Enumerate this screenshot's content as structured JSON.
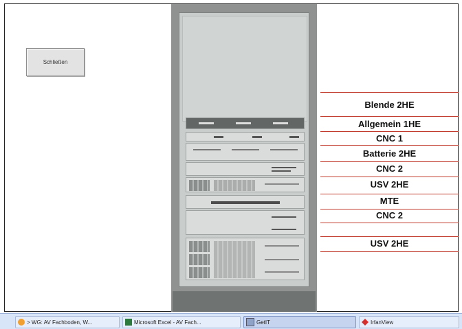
{
  "close_button": "Schließen",
  "rack_labels": [
    "Blende 2HE",
    "Allgemein 1HE",
    "CNC 1",
    "Batterie 2HE",
    "CNC 2",
    "USV 2HE",
    "MTE",
    "CNC 2",
    "USV 2HE"
  ],
  "taskbar": {
    "items": [
      {
        "label": "> WG: AV Fachboden, W...",
        "icon": "firefox-icon"
      },
      {
        "label": "Microsoft Excel - AV Fach...",
        "icon": "excel-icon"
      },
      {
        "label": "GetIT",
        "icon": "window-icon"
      },
      {
        "label": "IrfanView",
        "icon": "irfanview-icon"
      }
    ]
  },
  "colors": {
    "divider_line": "#c0392b",
    "rack_frame": "#8f9290"
  }
}
